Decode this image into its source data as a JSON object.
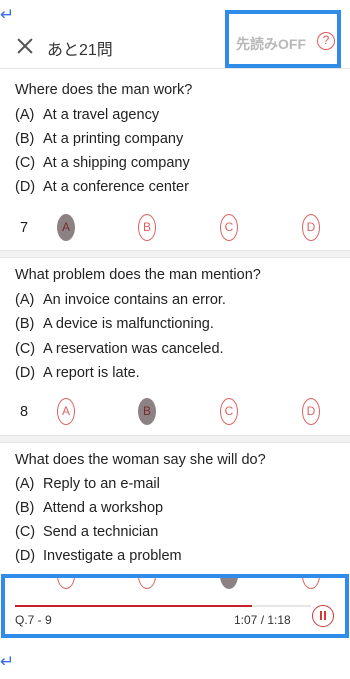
{
  "header": {
    "close_icon": "close-icon",
    "remaining_label": "あと21問",
    "preread_label": "先読みOFF",
    "help_symbol": "?"
  },
  "questions": [
    {
      "text": "Where does the man work?",
      "options": [
        {
          "letter": "(A)",
          "text": "At a travel agency"
        },
        {
          "letter": "(B)",
          "text": "At a printing company"
        },
        {
          "letter": "(C)",
          "text": "At a shipping company"
        },
        {
          "letter": "(D)",
          "text": "At a conference center"
        }
      ],
      "number": "7",
      "bubbles": [
        "A",
        "B",
        "C",
        "D"
      ],
      "selected": "A"
    },
    {
      "text": "What problem does the man mention?",
      "options": [
        {
          "letter": "(A)",
          "text": "An invoice contains an error."
        },
        {
          "letter": "(B)",
          "text": "A device is malfunctioning."
        },
        {
          "letter": "(C)",
          "text": "A reservation was canceled."
        },
        {
          "letter": "(D)",
          "text": "A report is late."
        }
      ],
      "number": "8",
      "bubbles": [
        "A",
        "B",
        "C",
        "D"
      ],
      "selected": "B"
    },
    {
      "text": "What does the woman say she will do?",
      "options": [
        {
          "letter": "(A)",
          "text": "Reply to an e-mail"
        },
        {
          "letter": "(B)",
          "text": "Attend a workshop"
        },
        {
          "letter": "(C)",
          "text": "Send a technician"
        },
        {
          "letter": "(D)",
          "text": "Investigate a problem"
        }
      ],
      "selected": "C"
    }
  ],
  "player": {
    "track_label": "Q.7 - 9",
    "time_label": "1:07 / 1:18",
    "progress": 0.8,
    "accent_color": "#c8202a",
    "pause_icon": "pause-icon"
  },
  "colors": {
    "highlight_border": "#2f8ce8",
    "bubble_outline": "#e06060",
    "bubble_selected": "#8c8284"
  },
  "return_glyph": "↵"
}
